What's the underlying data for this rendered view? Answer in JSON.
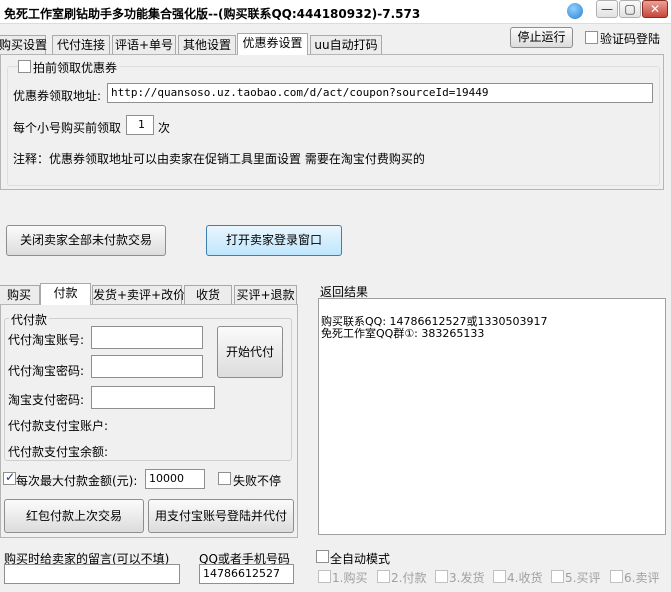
{
  "window": {
    "title": "免死工作室刷钻助手多功能集合强化版--(购买联系QQ:444180932)-7.573"
  },
  "top_tabs": [
    "购买设置",
    "代付连接",
    "评语+单号",
    "其他设置",
    "优惠券设置",
    "uu自动打码"
  ],
  "top_actions": {
    "stop_label": "停止运行",
    "captcha_label": "验证码登陆"
  },
  "coupon": {
    "prefetch_label": "拍前领取优惠券",
    "url_label": "优惠券领取地址:",
    "url_value": "http://quansoso.uz.taobao.com/d/act/coupon?sourceId=19449",
    "count_prefix": "每个小号购买前领取",
    "count_value": "1",
    "count_suffix": "次",
    "note": "注释：优惠券领取地址可以由卖家在促销工具里面设置 需要在淘宝付费购买的"
  },
  "actions": {
    "close_unpaid_label": "关闭卖家全部未付款交易",
    "open_seller_login_label": "打开卖家登录窗口"
  },
  "lower_tabs": [
    "购买",
    "付款",
    "发货+卖评+改价",
    "收货",
    "买评+退款"
  ],
  "payment": {
    "group_title": "代付款",
    "account_label": "代付淘宝账号:",
    "password_label": "代付淘宝密码:",
    "pay_password_label": "淘宝支付密码:",
    "alipay_account_label": "代付款支付宝账户:",
    "alipay_balance_label": "代付款支付宝余额:",
    "start_label": "开始代付",
    "max_amount_label": "每次最大付款金额(元):",
    "max_amount_value": "10000",
    "fail_stop_label": "失败不停",
    "redpacket_label": "红包付款上次交易",
    "alipay_login_label": "用支付宝账号登陆并代付"
  },
  "result": {
    "title": "返回结果",
    "lines": [
      "购买联系QQ: 14786612527或1330503917",
      "免死工作室QQ群①: 383265133"
    ]
  },
  "footer": {
    "message_label": "购买时给卖家的留言(可以不填)",
    "message_value": "",
    "qq_label": "QQ或者手机号码",
    "qq_value": "14786612527",
    "auto_mode_label": "全自动模式",
    "steps": [
      "1.购买",
      "2.付款",
      "3.发货",
      "4.收货",
      "5.买评",
      "6.卖评"
    ]
  }
}
